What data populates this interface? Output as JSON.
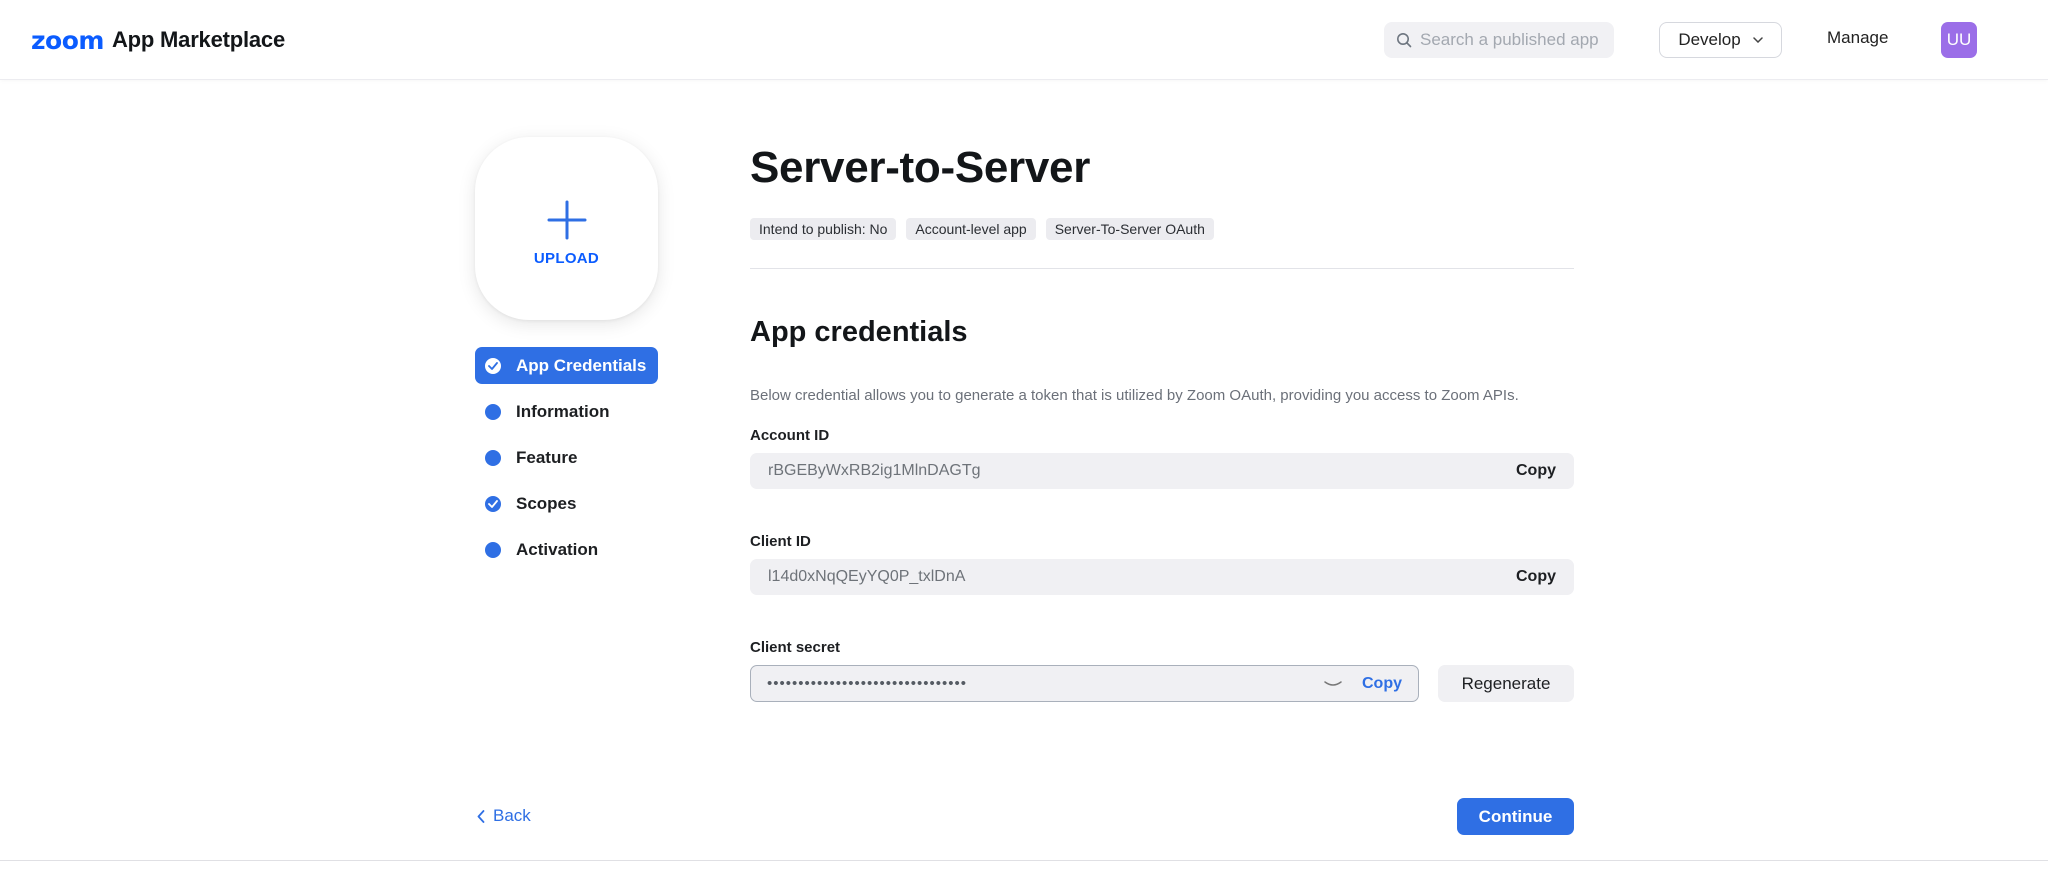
{
  "header": {
    "logo_brand": "zoom",
    "logo_title": "App Marketplace",
    "search_placeholder": "Search a published app",
    "develop_label": "Develop",
    "manage_label": "Manage",
    "avatar_initials": "UU",
    "avatar_color": "#9b6ee8"
  },
  "upload": {
    "label": "UPLOAD"
  },
  "sidebar": {
    "items": [
      {
        "label": "App Credentials",
        "active": true,
        "icon": "check-circle-icon"
      },
      {
        "label": "Information",
        "active": false,
        "icon": "dot-icon"
      },
      {
        "label": "Feature",
        "active": false,
        "icon": "dot-icon"
      },
      {
        "label": "Scopes",
        "active": false,
        "icon": "check-circle-icon"
      },
      {
        "label": "Activation",
        "active": false,
        "icon": "dot-icon"
      }
    ]
  },
  "main": {
    "title": "Server-to-Server",
    "tags": [
      "Intend to publish: No",
      "Account-level app",
      "Server-To-Server OAuth"
    ],
    "section_title": "App credentials",
    "description": "Below credential allows you to generate a token that is utilized by Zoom OAuth, providing you access to Zoom APIs.",
    "account_id": {
      "label": "Account ID",
      "value": "rBGEByWxRB2ig1MlnDAGTg",
      "copy_label": "Copy"
    },
    "client_id": {
      "label": "Client ID",
      "value": "l14d0xNqQEyYQ0P_txlDnA",
      "copy_label": "Copy"
    },
    "client_secret": {
      "label": "Client secret",
      "value": "••••••••••••••••••••••••••••••••",
      "copy_label": "Copy",
      "regenerate_label": "Regenerate"
    }
  },
  "footer": {
    "back_label": "Back",
    "continue_label": "Continue"
  },
  "colors": {
    "accent": "#2f6fe4",
    "brand": "#0b5cff"
  }
}
